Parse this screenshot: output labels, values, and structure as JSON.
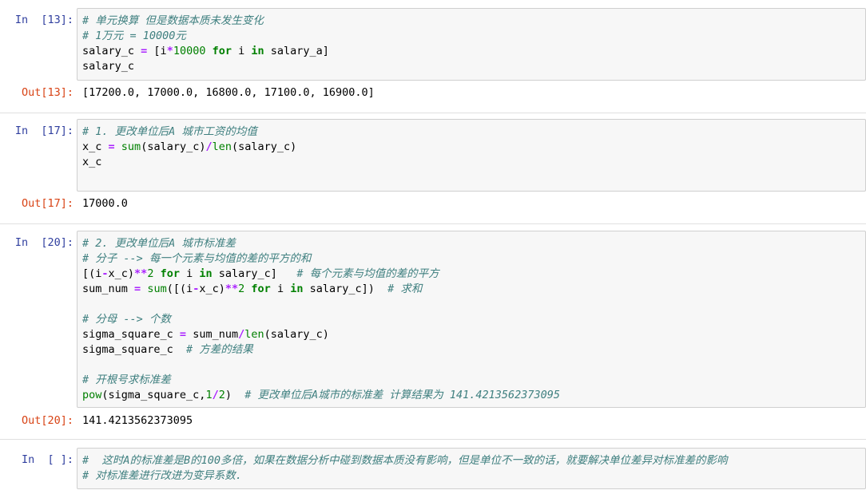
{
  "cells": [
    {
      "in_prompt": "In  [13]:",
      "out_prompt": "Out[13]:",
      "output": "[17200.0, 17000.0, 16800.0, 17100.0, 16900.0]",
      "lines": [
        [
          {
            "t": "# 单元换算 但是数据本质未发生变化",
            "c": "c"
          }
        ],
        [
          {
            "t": "# 1万元 = 10000元",
            "c": "c"
          }
        ],
        [
          {
            "t": "salary_c "
          },
          {
            "t": "=",
            "c": "o"
          },
          {
            "t": " [i"
          },
          {
            "t": "*",
            "c": "o"
          },
          {
            "t": "10000",
            "c": "m"
          },
          {
            "t": " "
          },
          {
            "t": "for",
            "c": "k"
          },
          {
            "t": " i "
          },
          {
            "t": "in",
            "c": "k"
          },
          {
            "t": " salary_a]"
          }
        ],
        [
          {
            "t": "salary_c"
          }
        ]
      ]
    },
    {
      "in_prompt": "In  [17]:",
      "out_prompt": "Out[17]:",
      "output": "17000.0",
      "lines": [
        [
          {
            "t": "# 1. 更改单位后A 城市工资的均值",
            "c": "c"
          }
        ],
        [
          {
            "t": "x_c "
          },
          {
            "t": "=",
            "c": "o"
          },
          {
            "t": " "
          },
          {
            "t": "sum",
            "c": "n"
          },
          {
            "t": "(salary_c)"
          },
          {
            "t": "/",
            "c": "o"
          },
          {
            "t": "len",
            "c": "n"
          },
          {
            "t": "(salary_c)"
          }
        ],
        [
          {
            "t": "x_c"
          }
        ]
      ]
    },
    {
      "in_prompt": "In  [20]:",
      "out_prompt": "Out[20]:",
      "output": "141.4213562373095",
      "lines": [
        [
          {
            "t": "# 2. 更改单位后A 城市标准差",
            "c": "c"
          }
        ],
        [
          {
            "t": "# 分子 --> 每一个元素与均值的差的平方的和",
            "c": "c"
          }
        ],
        [
          {
            "t": "[(i"
          },
          {
            "t": "-",
            "c": "o"
          },
          {
            "t": "x_c)"
          },
          {
            "t": "**",
            "c": "o"
          },
          {
            "t": "2",
            "c": "m"
          },
          {
            "t": " "
          },
          {
            "t": "for",
            "c": "k"
          },
          {
            "t": " i "
          },
          {
            "t": "in",
            "c": "k"
          },
          {
            "t": " salary_c]   "
          },
          {
            "t": "# 每个元素与均值的差的平方",
            "c": "c"
          }
        ],
        [
          {
            "t": "sum_num "
          },
          {
            "t": "=",
            "c": "o"
          },
          {
            "t": " "
          },
          {
            "t": "sum",
            "c": "n"
          },
          {
            "t": "([(i"
          },
          {
            "t": "-",
            "c": "o"
          },
          {
            "t": "x_c)"
          },
          {
            "t": "**",
            "c": "o"
          },
          {
            "t": "2",
            "c": "m"
          },
          {
            "t": " "
          },
          {
            "t": "for",
            "c": "k"
          },
          {
            "t": " i "
          },
          {
            "t": "in",
            "c": "k"
          },
          {
            "t": " salary_c])  "
          },
          {
            "t": "# 求和",
            "c": "c"
          }
        ],
        [
          {
            "t": ""
          }
        ],
        [
          {
            "t": "# 分母 --> 个数",
            "c": "c"
          }
        ],
        [
          {
            "t": "sigma_square_c "
          },
          {
            "t": "=",
            "c": "o"
          },
          {
            "t": " sum_num"
          },
          {
            "t": "/",
            "c": "o"
          },
          {
            "t": "len",
            "c": "n"
          },
          {
            "t": "(salary_c)"
          }
        ],
        [
          {
            "t": "sigma_square_c  "
          },
          {
            "t": "# 方差的结果",
            "c": "c"
          }
        ],
        [
          {
            "t": ""
          }
        ],
        [
          {
            "t": "# 开根号求标准差",
            "c": "c"
          }
        ],
        [
          {
            "t": "pow",
            "c": "n"
          },
          {
            "t": "(sigma_square_c,"
          },
          {
            "t": "1",
            "c": "m"
          },
          {
            "t": "/",
            "c": "o"
          },
          {
            "t": "2",
            "c": "m"
          },
          {
            "t": ")  "
          },
          {
            "t": "# 更改单位后A城市的标准差 计算结果为 141.4213562373095",
            "c": "c"
          }
        ]
      ]
    },
    {
      "in_prompt": "In  [ ]:",
      "out_prompt": "",
      "output": "",
      "lines": [
        [
          {
            "t": "#  这时A的标准差是B的100多倍，如果在数据分析中碰到数据本质没有影响，但是单位不一致的话，就要解决单位差异对标准差的影响",
            "c": "c"
          }
        ],
        [
          {
            "t": "# 对标准差进行改进为变异系数.",
            "c": "c"
          }
        ]
      ]
    }
  ]
}
